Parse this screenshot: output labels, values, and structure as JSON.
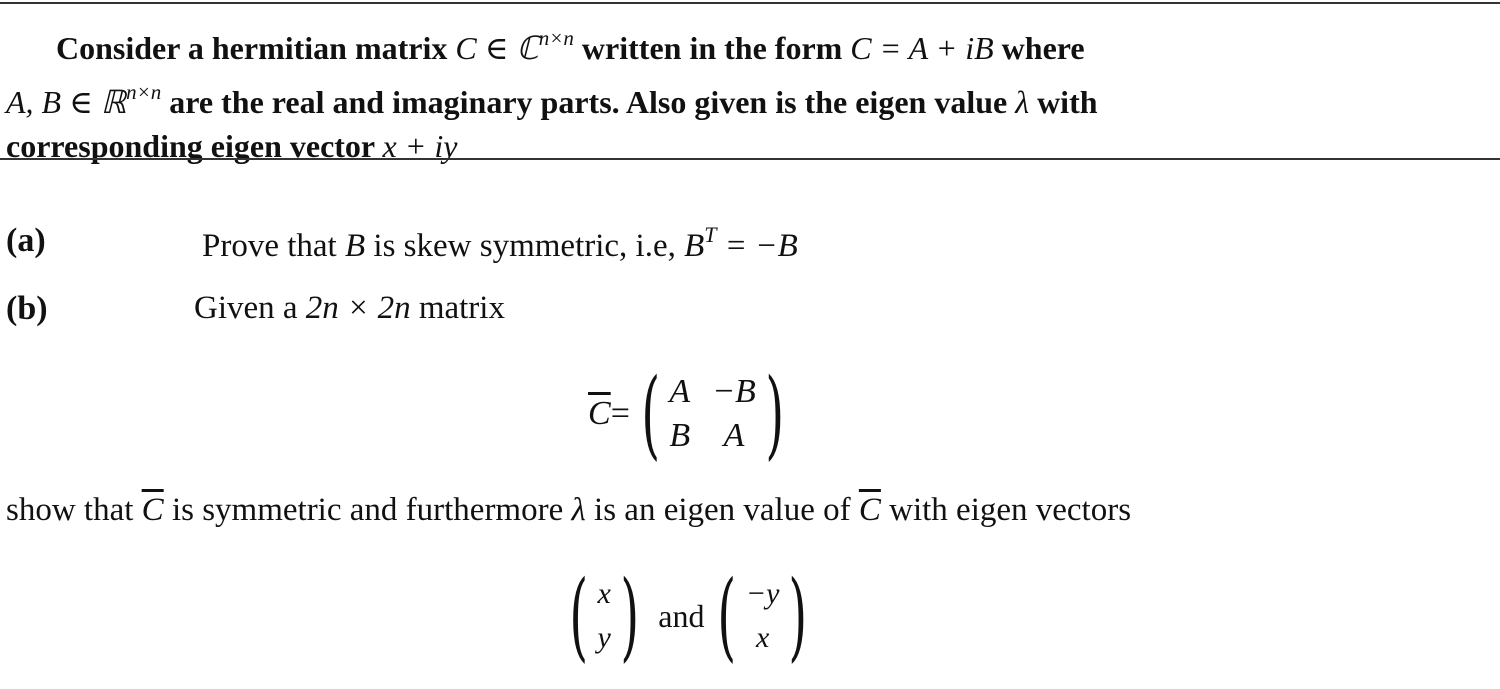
{
  "problem": {
    "intro_lines": [
      {
        "parts": [
          "Consider a hermitian matrix ",
          "C ∈ ℂ",
          "n×n",
          " written in the form ",
          "C = A + iB",
          " where"
        ]
      },
      {
        "parts": [
          "A, B ∈ ℝ",
          "n×n",
          " are the real and imaginary parts. Also given is the eigen value ",
          "λ",
          " with"
        ]
      },
      {
        "parts": [
          "corresponding eigen vector ",
          "x + iy"
        ]
      }
    ],
    "part_a": {
      "label": "(a)",
      "text": "Prove that ",
      "var": "B",
      "text2": " is skew symmetric, i.e, ",
      "eq_lhs": "B",
      "eq_sup": "T",
      "eq_rhs": " = −B"
    },
    "part_b": {
      "label": "(b)",
      "text": "Given a ",
      "dims": "2n × 2n",
      "text2": " matrix"
    },
    "matrix": {
      "lhs": "C",
      "equals": " = ",
      "cells": [
        "A",
        "−B",
        "B",
        "A"
      ]
    },
    "show_line": {
      "t1": "show that ",
      "c1": "C",
      "t2": " is symmetric and furthermore ",
      "lambda": "λ",
      "t3": " is an eigen value of ",
      "c2": "C",
      "t4": " with eigen vectors"
    },
    "vectors": {
      "v1": [
        "x",
        "y"
      ],
      "conj": "and",
      "v2": [
        "−y",
        "x"
      ]
    }
  }
}
